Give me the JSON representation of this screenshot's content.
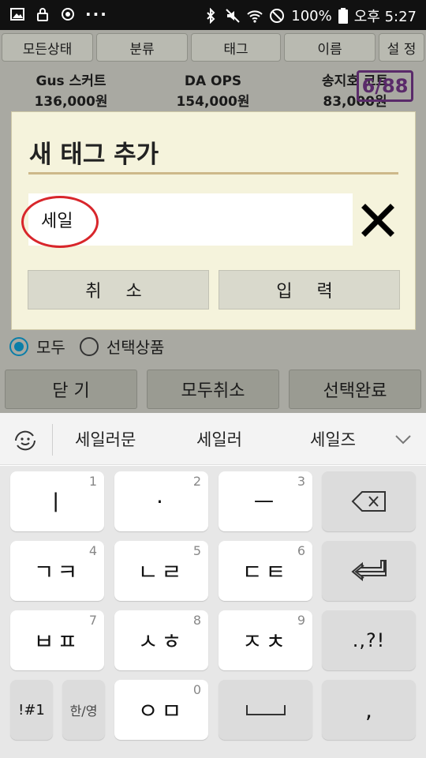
{
  "status_bar": {
    "battery": "100%",
    "time": "오후 5:27",
    "dots": "···"
  },
  "tabs": [
    {
      "label": "모든상태"
    },
    {
      "label": "분류"
    },
    {
      "label": "태그"
    },
    {
      "label": "이름"
    },
    {
      "label": "설 정"
    }
  ],
  "products": [
    {
      "name": "Gus 스커트",
      "price": "136,000원"
    },
    {
      "name": "DA OPS",
      "price": "154,000원"
    },
    {
      "name": "송지호 코트",
      "price": "83,000원"
    }
  ],
  "count_badge": "6/88",
  "radio_options": [
    {
      "label": "모두",
      "selected": true
    },
    {
      "label": "선택상품",
      "selected": false
    }
  ],
  "bottom_buttons": [
    {
      "label": "닫 기"
    },
    {
      "label": "모두취소"
    },
    {
      "label": "선택완료"
    }
  ],
  "dialog": {
    "title": "새 태그 추가",
    "input_value": "세일",
    "cancel_label": "취 소",
    "confirm_label": "입 력",
    "colors": {
      "background": "#f5f3dc",
      "title_line": "#cdb88a",
      "annotation": "#d8262b"
    }
  },
  "suggestions": [
    "세일러문",
    "세일러",
    "세일즈"
  ],
  "keyboard": {
    "keys": [
      {
        "label": "ㅣ",
        "num": "1"
      },
      {
        "label": "·",
        "num": "2"
      },
      {
        "label": "ㅡ",
        "num": "3"
      },
      {
        "label": "backspace-icon",
        "num": ""
      },
      {
        "label": "ㄱㅋ",
        "num": "4"
      },
      {
        "label": "ㄴㄹ",
        "num": "5"
      },
      {
        "label": "ㄷㅌ",
        "num": "6"
      },
      {
        "label": "enter-icon",
        "num": ""
      },
      {
        "label": "ㅂㅍ",
        "num": "7"
      },
      {
        "label": "ㅅㅎ",
        "num": "8"
      },
      {
        "label": "ㅈㅊ",
        "num": "9"
      },
      {
        "label": ".,?!",
        "num": ""
      },
      {
        "label": "!#1",
        "num": ""
      },
      {
        "label": "한/영",
        "num": ""
      },
      {
        "label": "ㅇㅁ",
        "num": "0"
      },
      {
        "label": "space-icon",
        "num": ""
      },
      {
        "label": ",",
        "num": ""
      }
    ]
  }
}
